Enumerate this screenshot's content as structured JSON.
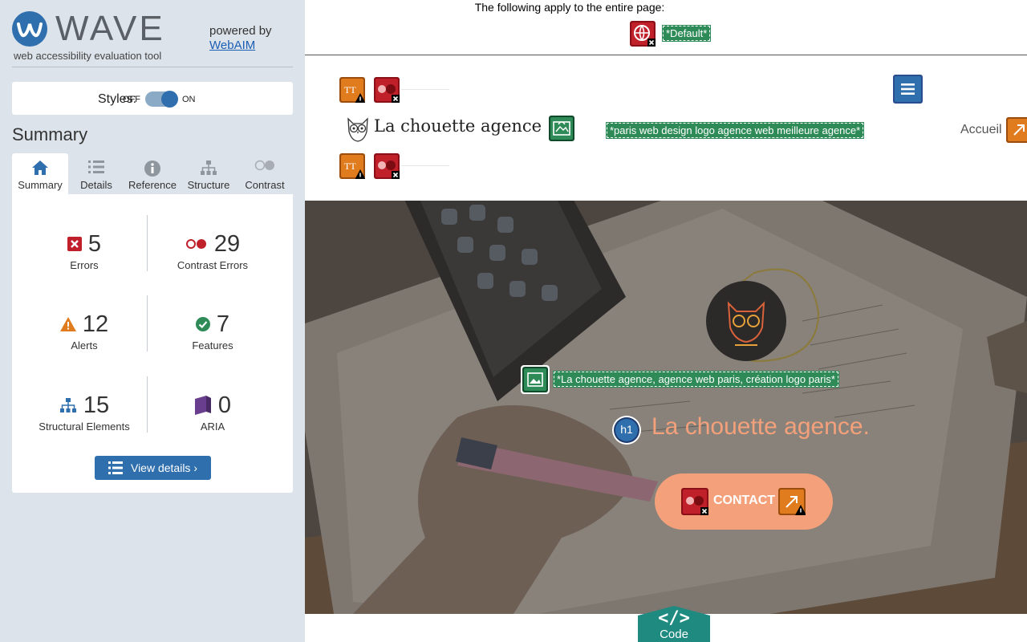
{
  "wave": {
    "name": "WAVE",
    "tagline": "web accessibility evaluation tool",
    "powered_by": "powered by",
    "webaim": "WebAIM"
  },
  "styles": {
    "label": "Styles:",
    "off": "OFF",
    "on": "ON",
    "state": "on"
  },
  "summary": {
    "heading": "Summary",
    "tabs": [
      "Summary",
      "Details",
      "Reference",
      "Structure",
      "Contrast"
    ],
    "active_tab": "Summary",
    "stats": [
      {
        "count": "5",
        "label": "Errors"
      },
      {
        "count": "29",
        "label": "Contrast Errors"
      },
      {
        "count": "12",
        "label": "Alerts"
      },
      {
        "count": "7",
        "label": "Features"
      },
      {
        "count": "15",
        "label": "Structural Elements"
      },
      {
        "count": "0",
        "label": "ARIA"
      }
    ],
    "view_details": "View details ›"
  },
  "page": {
    "top_text": "The following apply to the entire page:",
    "lang_label": "*Default*",
    "logo_text": "La chouette agence",
    "logo_alt": "*paris web design logo agence web meilleure agence*",
    "nav_item": "Accueil",
    "hero_alt": "*La chouette agence, agence web paris, création logo paris*",
    "h1_badge": "h1",
    "h1_text": "La chouette agence.",
    "contact": "CONTACT"
  },
  "code_tab": {
    "symbol": "</>",
    "label": "Code"
  },
  "colors": {
    "wave_blue": "#2f6fad",
    "error_red": "#c0202a",
    "alert_orange": "#e07b1e",
    "feature_green": "#2e8b57",
    "aria_purple": "#6a3e8e",
    "hero_title": "#f4a07a",
    "contact_button": "#f4a07a",
    "code_teal": "#1f8a80"
  }
}
